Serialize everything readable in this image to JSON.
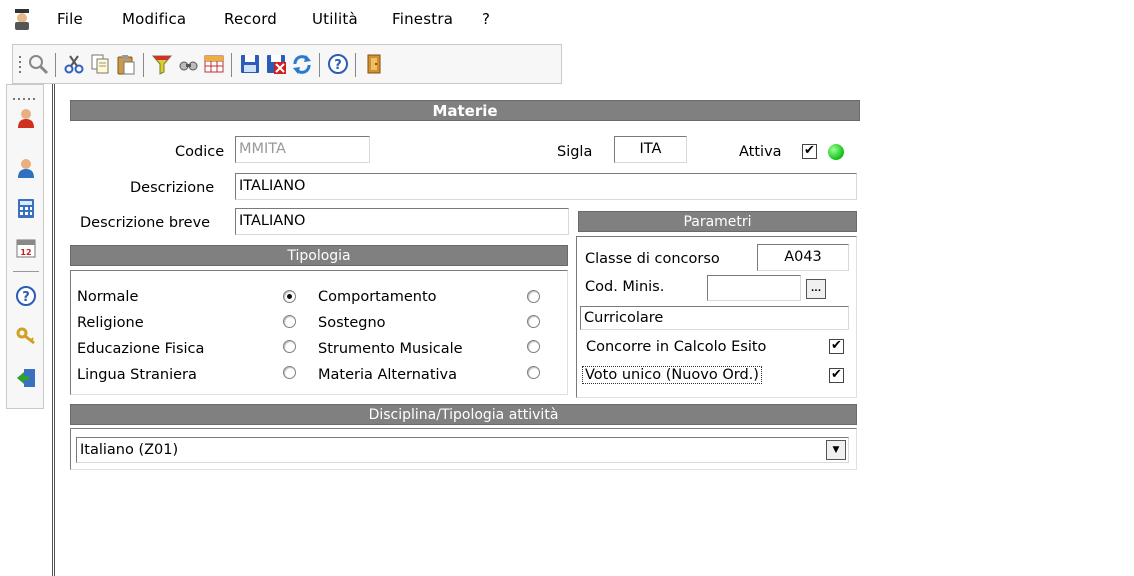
{
  "menu": {
    "items": [
      "File",
      "Modifica",
      "Record",
      "Utilità",
      "Finestra",
      "?"
    ]
  },
  "toolbar": {
    "icons": [
      "grip-icon",
      "preview-icon",
      "cut-icon",
      "copy-icon",
      "paste-icon",
      "filter-icon",
      "find-icon",
      "grid-icon",
      "save-icon",
      "delete-icon",
      "refresh-icon",
      "help-icon",
      "exit-icon"
    ]
  },
  "sidebar": {
    "icons": [
      "user-red-icon",
      "user-blue-icon",
      "calculator-icon",
      "calendar-icon",
      "help-icon",
      "keys-icon",
      "exit-icon"
    ]
  },
  "form": {
    "title": "Materie",
    "codice_label": "Codice",
    "codice_value": "MMITA",
    "sigla_label": "Sigla",
    "sigla_value": "ITA",
    "attiva_label": "Attiva",
    "attiva_checked": true,
    "status_color": "#22c922",
    "descrizione_label": "Descrizione",
    "descrizione_value": "ITALIANO",
    "descrizione_breve_label": "Descrizione breve",
    "descrizione_breve_value": "ITALIANO"
  },
  "tipologia": {
    "title": "Tipologia",
    "left": [
      {
        "label": "Normale",
        "selected": true
      },
      {
        "label": "Religione",
        "selected": false
      },
      {
        "label": "Educazione Fisica",
        "selected": false
      },
      {
        "label": "Lingua Straniera",
        "selected": false
      }
    ],
    "right": [
      {
        "label": "Comportamento",
        "selected": false
      },
      {
        "label": "Sostegno",
        "selected": false
      },
      {
        "label": "Strumento Musicale",
        "selected": false
      },
      {
        "label": "Materia Alternativa",
        "selected": false
      }
    ]
  },
  "parametri": {
    "title": "Parametri",
    "classe_label": "Classe di concorso",
    "classe_value": "A043",
    "cod_minis_label": "Cod. Minis.",
    "cod_minis_value": "",
    "lookup_label": "...",
    "tipo_value": "Curricolare",
    "concorre_label": "Concorre in Calcolo Esito",
    "concorre_checked": true,
    "voto_label": "Voto unico (Nuovo Ord.)",
    "voto_checked": true
  },
  "disciplina": {
    "title": "Disciplina/Tipologia attività",
    "selected": "Italiano (Z01)"
  },
  "colors": {
    "header_bg": "#808080",
    "header_text": "#ffffff",
    "disabled_text": "#9a9a9a"
  }
}
